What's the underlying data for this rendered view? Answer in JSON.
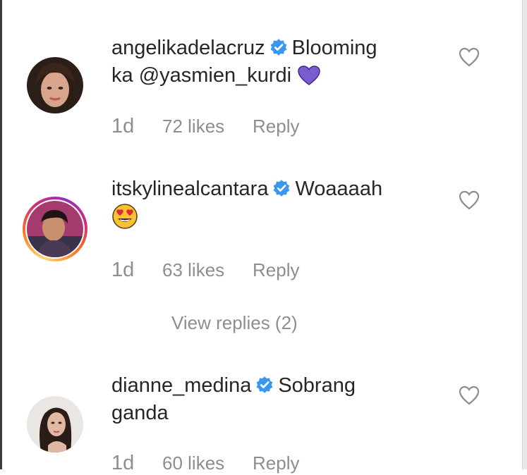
{
  "comments": [
    {
      "username": "angelikadelacruz",
      "text_before": "Blooming",
      "text_line2": "ka",
      "mention": "@yasmien_kurdi",
      "emoji": "purple-heart",
      "time": "1d",
      "likes": "72 likes",
      "reply": "Reply"
    },
    {
      "username": "itskylinealcantara",
      "text_before": "Woaaaah",
      "emoji": "heart-eyes-face",
      "time": "1d",
      "likes": "63 likes",
      "reply": "Reply",
      "view_replies": "View replies (2)"
    },
    {
      "username": "dianne_medina",
      "text_before": "Sobrang",
      "text_line2": "ganda",
      "time": "1d",
      "likes": "60 likes",
      "reply": "Reply"
    }
  ],
  "colors": {
    "text": "#262626",
    "secondary": "#8e8e8e",
    "verified": "#3897f0",
    "purple_heart": "#7b5ccf"
  }
}
